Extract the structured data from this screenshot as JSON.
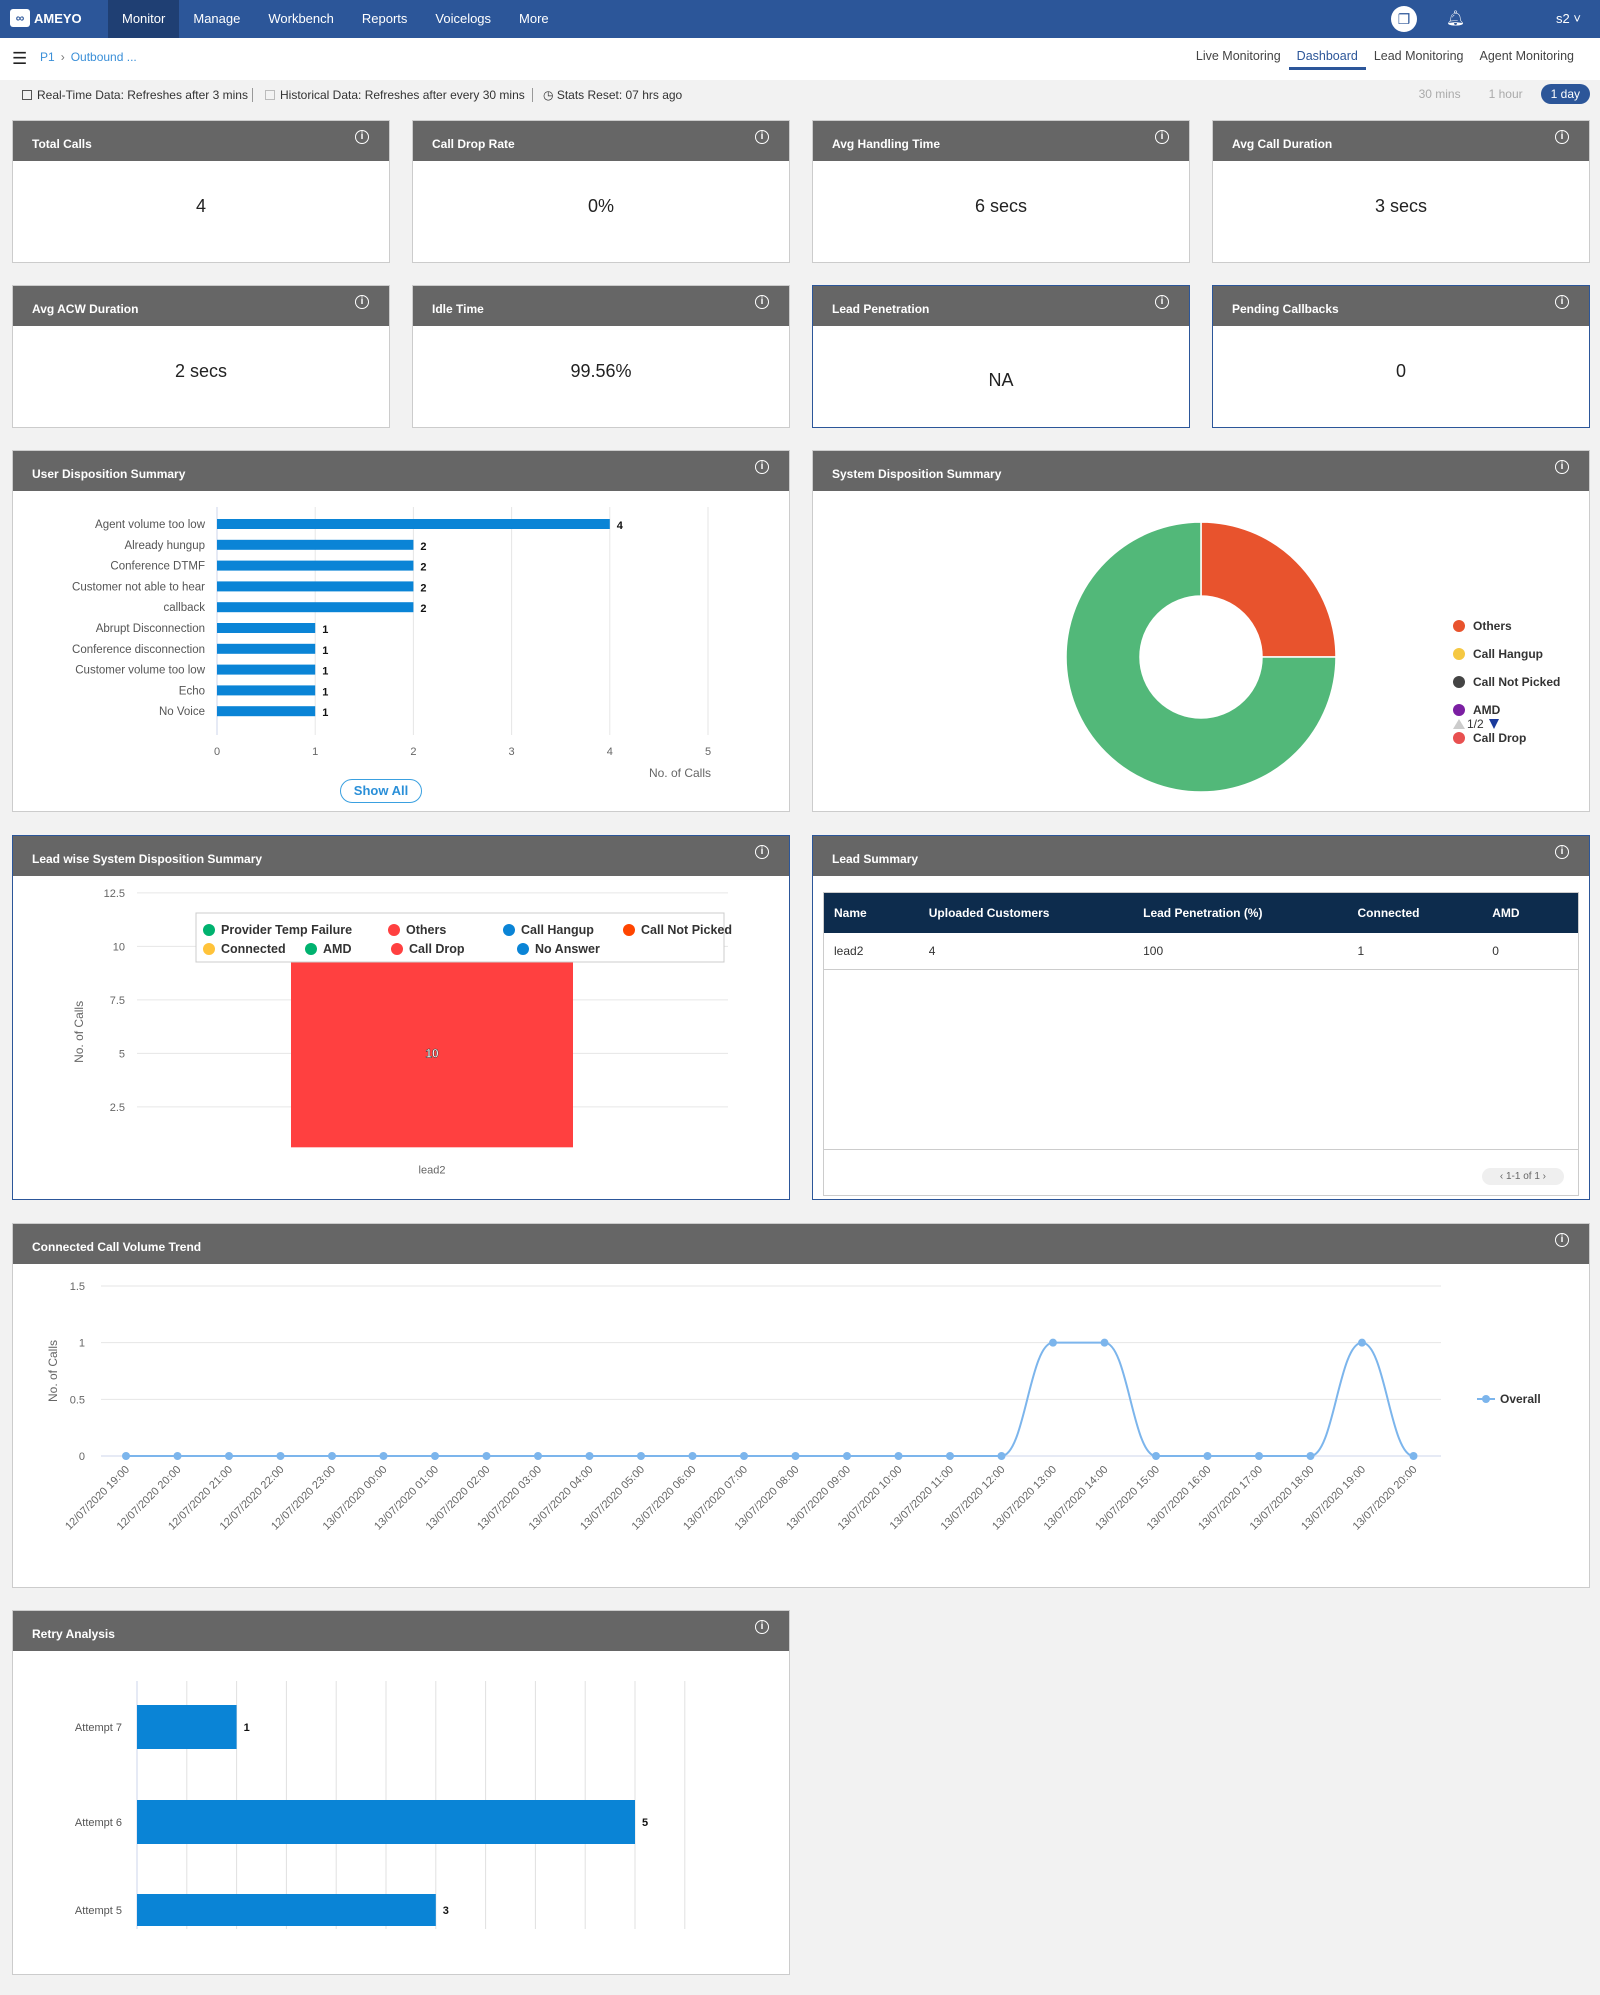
{
  "nav": {
    "logo": "AMEYO",
    "items": [
      "Monitor",
      "Manage",
      "Workbench",
      "Reports",
      "Voicelogs",
      "More"
    ],
    "active": "Monitor",
    "user": "s2"
  },
  "breadcrumb": [
    "P1",
    "Outbound ..."
  ],
  "tabs": [
    "Live Monitoring",
    "Dashboard",
    "Lead Monitoring",
    "Agent Monitoring"
  ],
  "active_tab": "Dashboard",
  "status": {
    "realtime": "Real-Time Data: Refreshes after 3 mins",
    "historical": "Historical Data: Refreshes after every 30 mins",
    "reset": "Stats Reset: 07 hrs ago"
  },
  "ranges": [
    "30 mins",
    "1 hour",
    "1 day"
  ],
  "active_range": "1 day",
  "cards": [
    {
      "title": "Total Calls",
      "value": "4"
    },
    {
      "title": "Call Drop Rate",
      "value": "0%"
    },
    {
      "title": "Avg Handling Time",
      "value": "6 secs"
    },
    {
      "title": "Avg Call Duration",
      "value": "3 secs"
    },
    {
      "title": "Avg ACW Duration",
      "value": "2 secs"
    },
    {
      "title": "Idle Time",
      "value": "99.56%"
    },
    {
      "title": "Lead Penetration",
      "value": "NA"
    },
    {
      "title": "Pending Callbacks",
      "value": "0"
    }
  ],
  "colors": {
    "accent": "#2c5699",
    "bar": "#0a84d6",
    "header": "#666666"
  },
  "chart_data": [
    {
      "title": "User Disposition Summary",
      "type": "bar",
      "orientation": "horizontal",
      "categories": [
        "Agent volume too low",
        "Already hungup",
        "Conference DTMF",
        "Customer not able to hear",
        "callback",
        "Abrupt Disconnection",
        "Conference disconnection",
        "Customer volume too low",
        "Echo",
        "No Voice"
      ],
      "values": [
        4,
        2,
        2,
        2,
        2,
        1,
        1,
        1,
        1,
        1
      ],
      "xlabel": "No. of Calls",
      "xlim": [
        0,
        5
      ],
      "xticks": [
        "0",
        "1",
        "2",
        "3",
        "4",
        "5"
      ],
      "button": "Show All"
    },
    {
      "title": "System Disposition Summary",
      "type": "pie",
      "donut": true,
      "slices": [
        {
          "color": "#e8532d",
          "share": 25
        },
        {
          "color": "#52b879",
          "share": 75
        }
      ],
      "legend": [
        {
          "name": "Others",
          "color": "#e8532d"
        },
        {
          "name": "Call Hangup",
          "color": "#f5c842"
        },
        {
          "name": "Call Not Picked",
          "color": "#444444"
        },
        {
          "name": "AMD",
          "color": "#7b1fa2"
        },
        {
          "name": "Call Drop",
          "color": "#e85050"
        }
      ],
      "legend_page": "1/2",
      "legend_placement": "right"
    },
    {
      "title": "Lead wise System Disposition Summary",
      "type": "bar",
      "stacked": true,
      "categories": [
        "lead2"
      ],
      "series": [
        {
          "name": "Call Drop",
          "color": "#ff4040",
          "values": [
            10
          ]
        }
      ],
      "data_labels": [
        "10"
      ],
      "ylabel": "No. of Calls",
      "ylim": [
        0,
        12.5
      ],
      "yticks": [
        "2.5",
        "5",
        "7.5",
        "10",
        "12.5"
      ],
      "legend": [
        {
          "name": "Provider Temp Failure",
          "color": "#00b26f"
        },
        {
          "name": "Others",
          "color": "#ff4040"
        },
        {
          "name": "Call Hangup",
          "color": "#0a84d6"
        },
        {
          "name": "Call Not Picked",
          "color": "#ff4500"
        },
        {
          "name": "Connected",
          "color": "#ffc33a"
        },
        {
          "name": "AMD",
          "color": "#00b26f"
        },
        {
          "name": "Call Drop",
          "color": "#ff4040"
        },
        {
          "name": "No Answer",
          "color": "#0a84d6"
        }
      ],
      "legend_placement": "top"
    },
    {
      "title": "Connected Call Volume Trend",
      "type": "line",
      "x": [
        "12/07/2020 19:00",
        "12/07/2020 20:00",
        "12/07/2020 21:00",
        "12/07/2020 22:00",
        "12/07/2020 23:00",
        "13/07/2020 00:00",
        "13/07/2020 01:00",
        "13/07/2020 02:00",
        "13/07/2020 03:00",
        "13/07/2020 04:00",
        "13/07/2020 05:00",
        "13/07/2020 06:00",
        "13/07/2020 07:00",
        "13/07/2020 08:00",
        "13/07/2020 09:00",
        "13/07/2020 10:00",
        "13/07/2020 11:00",
        "13/07/2020 12:00",
        "13/07/2020 13:00",
        "13/07/2020 14:00",
        "13/07/2020 15:00",
        "13/07/2020 16:00",
        "13/07/2020 17:00",
        "13/07/2020 18:00",
        "13/07/2020 19:00",
        "13/07/2020 20:00"
      ],
      "series": [
        {
          "name": "Overall",
          "color": "#7cb5ec",
          "values": [
            0,
            0,
            0,
            0,
            0,
            0,
            0,
            0,
            0,
            0,
            0,
            0,
            0,
            0,
            0,
            0,
            0,
            0,
            1,
            1,
            0,
            0,
            0,
            0,
            1,
            0
          ]
        }
      ],
      "ylabel": "No. of Calls",
      "ylim": [
        0,
        1.5
      ],
      "yticks": [
        "0",
        "0.5",
        "1",
        "1.5"
      ],
      "legend_placement": "right"
    },
    {
      "title": "Retry Analysis",
      "type": "bar",
      "orientation": "horizontal",
      "categories": [
        "Attempt 7",
        "Attempt 6",
        "Attempt 5"
      ],
      "values": [
        1,
        5,
        3
      ],
      "xlim": [
        0,
        5.5
      ]
    }
  ],
  "lead_summary": {
    "title": "Lead Summary",
    "columns": [
      "Name",
      "Uploaded Customers",
      "Lead Penetration (%)",
      "Connected",
      "AMD"
    ],
    "rows": [
      [
        "lead2",
        "4",
        "100",
        "1",
        "0"
      ]
    ],
    "pager": "1-1 of 1"
  }
}
